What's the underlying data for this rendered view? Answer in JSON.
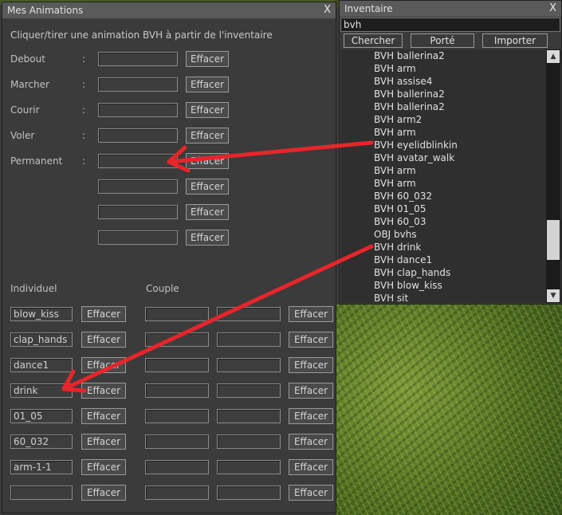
{
  "animations_window": {
    "title": "Mes Animations",
    "close": "X",
    "instruction": "Cliquer/tirer une animation BVH à partir de l'inventaire",
    "clear_label": "Effacer",
    "named_rows": [
      {
        "label": "Debout",
        "colon": ":",
        "value": ""
      },
      {
        "label": "Marcher",
        "colon": ":",
        "value": ""
      },
      {
        "label": "Courir",
        "colon": ":",
        "value": ""
      },
      {
        "label": "Voler",
        "colon": ":",
        "value": ""
      },
      {
        "label": "Permanent",
        "colon": ":",
        "value": ""
      },
      {
        "label": "",
        "colon": "",
        "value": ""
      },
      {
        "label": "",
        "colon": "",
        "value": ""
      },
      {
        "label": "",
        "colon": "",
        "value": ""
      }
    ],
    "individual_heading": "Individuel",
    "couple_heading": "Couple",
    "individual_rows": [
      "blow_kiss",
      "clap_hands",
      "dance1",
      "drink",
      "01_05",
      "60_032",
      "arm-1-1",
      ""
    ]
  },
  "inventory_window": {
    "title": "Inventaire",
    "close": "X",
    "search_value": "bvh",
    "buttons": [
      "Chercher",
      "Porté",
      "Importer"
    ],
    "items": [
      "BVH ballerina2",
      "BVH arm",
      "BVH assise4",
      "BVH ballerina2",
      "BVH ballerina2",
      "BVH arm2",
      "BVH arm",
      "BVH eyelidblinkin",
      "BVH avatar_walk",
      "BVH arm",
      "BVH arm",
      "BVH 60_032",
      "BVH 01_05",
      "BVH 60_03",
      "OBJ bvhs",
      "BVH drink",
      "BVH dance1",
      "BVH clap_hands",
      "BVH blow_kiss",
      "BVH sit"
    ],
    "scroll_up_icon": "▲",
    "scroll_down_icon": "▼"
  },
  "colors": {
    "arrow": "#e8252a",
    "panel": "#3b3b3b",
    "titlebar": "#5a5a5a"
  },
  "icons": [
    "close-icon",
    "scroll-up-icon",
    "scroll-down-icon",
    "arrow-annotation"
  ]
}
